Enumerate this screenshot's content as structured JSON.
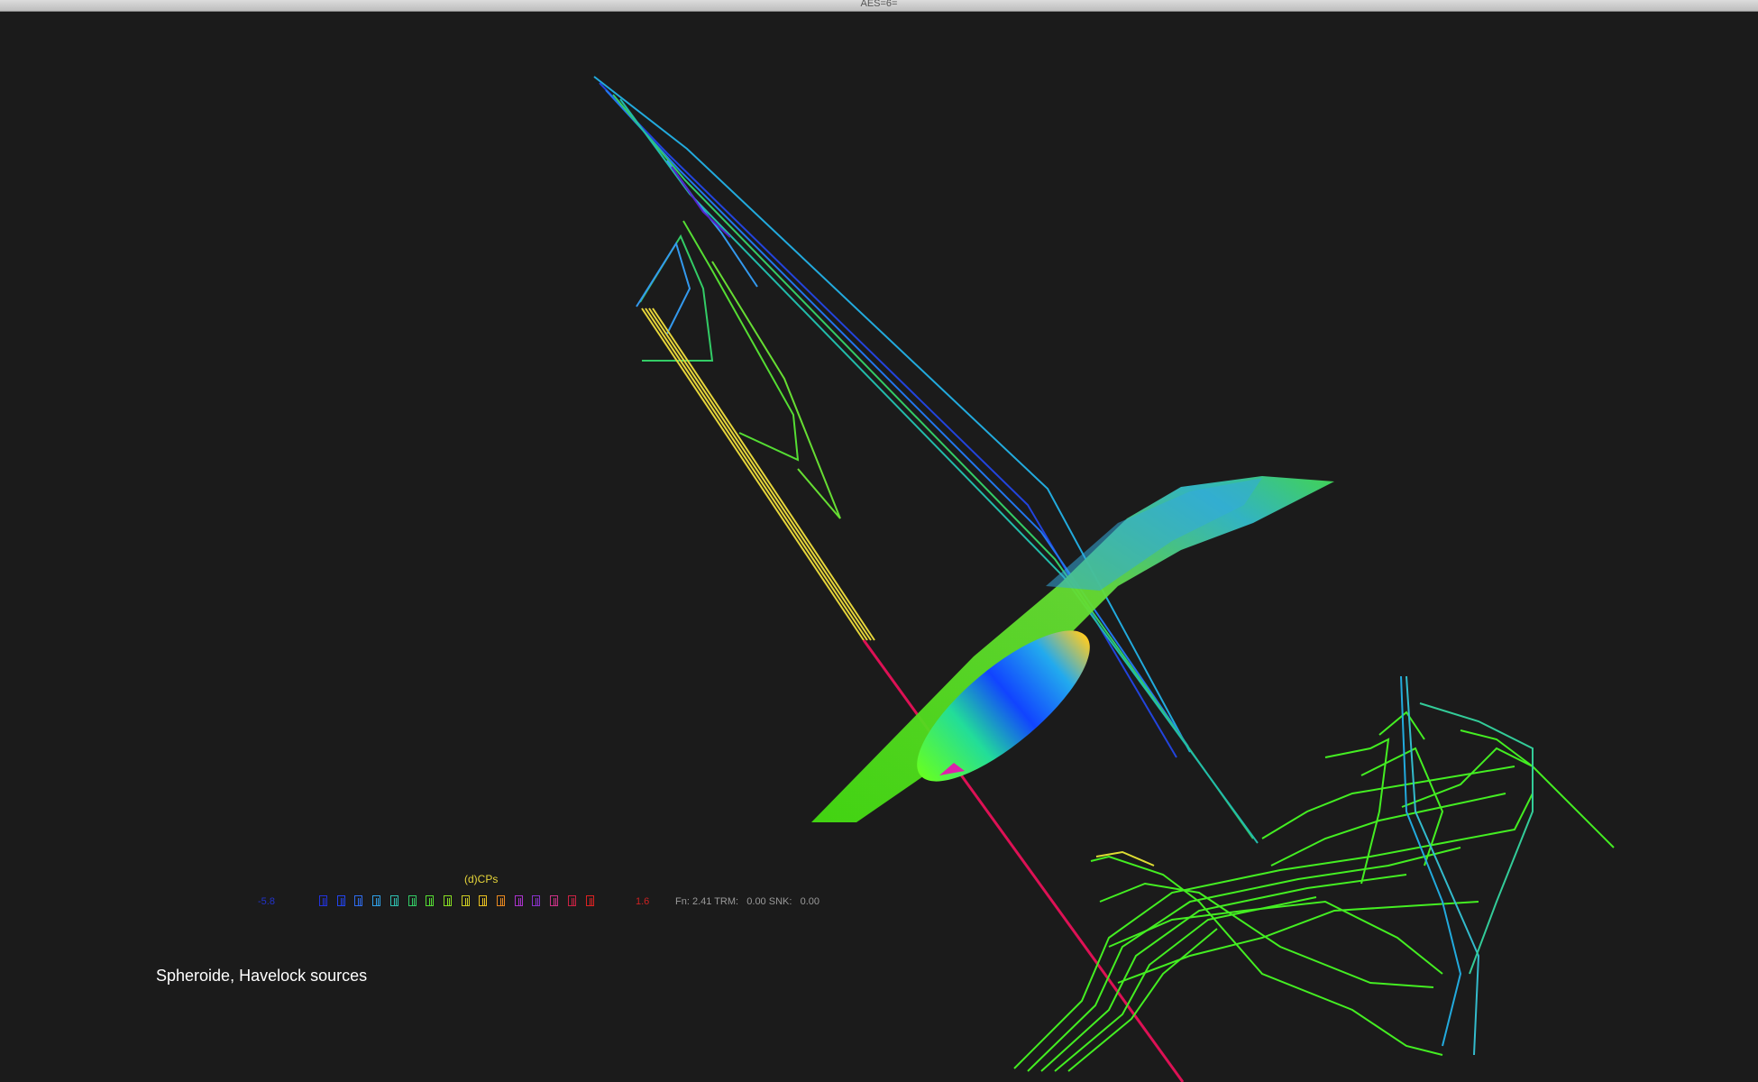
{
  "window": {
    "title": "AES=6="
  },
  "legend": {
    "title": "(d)CPs",
    "min_label": "-5.8",
    "max_label": "1.6",
    "swatch_colors": [
      "#2233dd",
      "#2244ee",
      "#2f6cf0",
      "#2fa0e8",
      "#2fc0b0",
      "#33cc66",
      "#55dd33",
      "#88dd22",
      "#cccc22",
      "#e8c020",
      "#e88820",
      "#aa33cc",
      "#8833cc",
      "#cc3388",
      "#cc2244",
      "#dd2222"
    ]
  },
  "stats": {
    "text": "Fn: 2.41 TRM:   0.00 SNK:   0.00"
  },
  "caption": {
    "text": "Spheroide, Havelock sources"
  },
  "colors": {
    "background": "#1b1b1b",
    "hull_green": "#55dd22",
    "mesh_green": "#33ee22",
    "wake_yellow": "#e6d53a",
    "axis_red": "#dd1155"
  }
}
